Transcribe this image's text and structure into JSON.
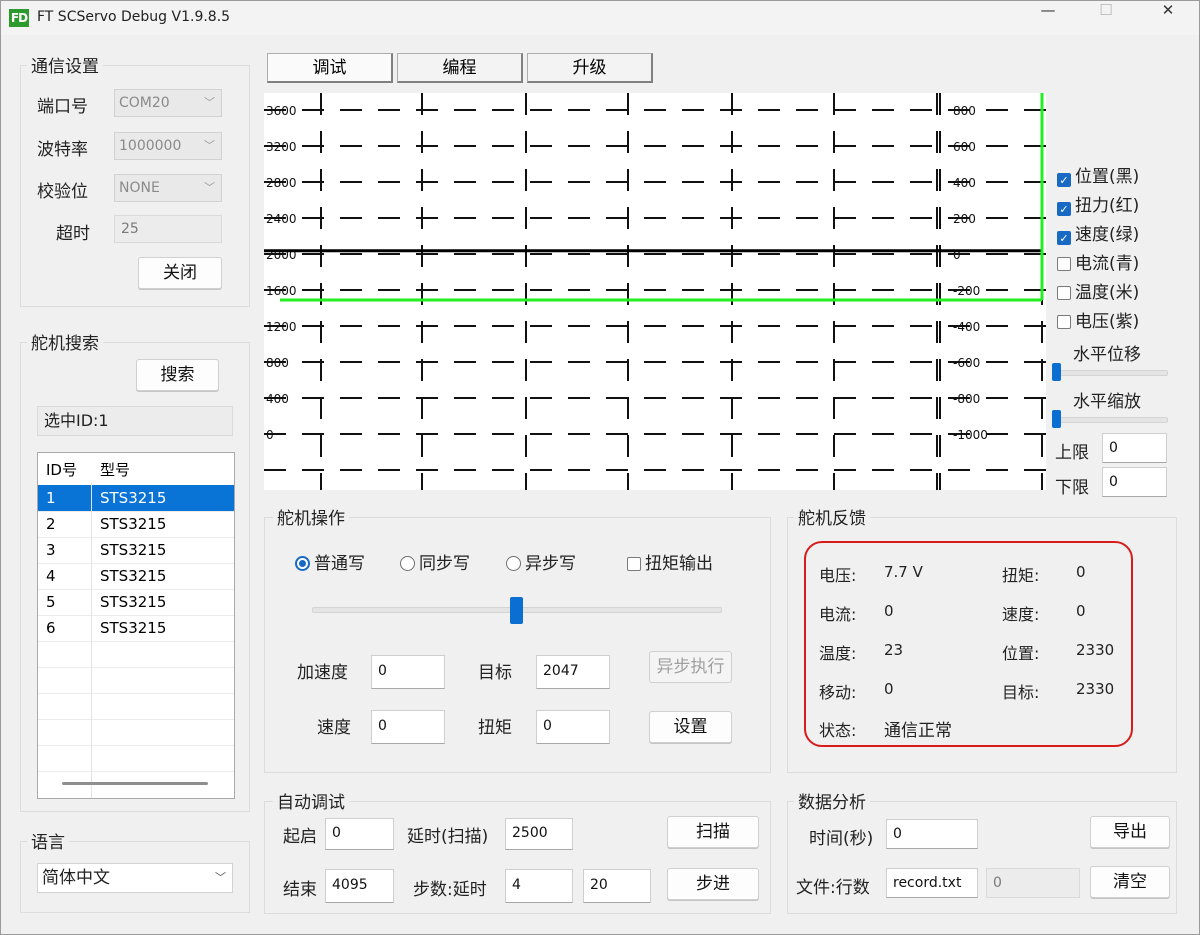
{
  "window": {
    "title": "FT SCServo Debug V1.9.8.5",
    "icon_text": "FD",
    "minimize": "—",
    "maximize": "☐",
    "close": "✕"
  },
  "comm": {
    "title": "通信设置",
    "port_label": "端口号",
    "port_value": "COM20",
    "baud_label": "波特率",
    "baud_value": "1000000",
    "parity_label": "校验位",
    "parity_value": "NONE",
    "timeout_label": "超时",
    "timeout_value": "25",
    "close_button": "关闭"
  },
  "search": {
    "title": "舵机搜索",
    "button": "搜索",
    "selected": "选中ID:1",
    "col_id": "ID号",
    "col_model": "型号",
    "rows": [
      {
        "id": "1",
        "model": "STS3215"
      },
      {
        "id": "2",
        "model": "STS3215"
      },
      {
        "id": "3",
        "model": "STS3215"
      },
      {
        "id": "4",
        "model": "STS3215"
      },
      {
        "id": "5",
        "model": "STS3215"
      },
      {
        "id": "6",
        "model": "STS3215"
      }
    ],
    "selected_index": 0
  },
  "language": {
    "title": "语言",
    "value": "简体中文"
  },
  "tabs": [
    {
      "label": "调试"
    },
    {
      "label": "编程"
    },
    {
      "label": "升级"
    }
  ],
  "active_tab": 0,
  "chart": {
    "left_ticks": [
      "3600",
      "3200",
      "2800",
      "2400",
      "2000",
      "1600",
      "1200",
      "800",
      "400",
      "0"
    ],
    "right_ticks": [
      "800",
      "600",
      "400",
      "200",
      "0",
      "-200",
      "-400",
      "-600",
      "-800",
      "-1000"
    ],
    "position_level": 2047,
    "speed_level": -250,
    "position_color": "#000000",
    "speed_color": "#22ee22"
  },
  "legend": [
    {
      "label": "位置(黑)",
      "checked": true
    },
    {
      "label": "扭力(红)",
      "checked": true
    },
    {
      "label": "速度(绿)",
      "checked": true
    },
    {
      "label": "电流(青)",
      "checked": false
    },
    {
      "label": "温度(米)",
      "checked": false
    },
    {
      "label": "电压(紫)",
      "checked": false
    }
  ],
  "hscroll": {
    "shift_label": "水平位移",
    "zoom_label": "水平缩放",
    "upper_label": "上限",
    "upper_value": "0",
    "lower_label": "下限",
    "lower_value": "0"
  },
  "op": {
    "title": "舵机操作",
    "radio_normal": "普通写",
    "radio_sync": "同步写",
    "radio_async": "异步写",
    "torque_out": "扭矩输出",
    "slider_value": 0.5,
    "accel_label": "加速度",
    "accel_value": "0",
    "target_label": "目标",
    "target_value": "2047",
    "async_exec": "异步执行",
    "speed_label": "速度",
    "speed_value": "0",
    "torque_label": "扭矩",
    "torque_value": "0",
    "set_button": "设置"
  },
  "feedback": {
    "title": "舵机反馈",
    "voltage_label": "电压:",
    "voltage_value": "7.7 V",
    "torque_label": "扭矩:",
    "torque_value": "0",
    "current_label": "电流:",
    "current_value": "0",
    "speed_label": "速度:",
    "speed_value": "0",
    "temp_label": "温度:",
    "temp_value": "23",
    "position_label": "位置:",
    "position_value": "2330",
    "move_label": "移动:",
    "move_value": "0",
    "target_label": "目标:",
    "target_value": "2330",
    "status_label": "状态:",
    "status_value": "通信正常",
    "highlight_color": "#d81c1c"
  },
  "auto": {
    "title": "自动调试",
    "start_label": "起启",
    "start_value": "0",
    "delay_scan_label": "延时(扫描)",
    "delay_scan_value": "2500",
    "scan_button": "扫描",
    "end_label": "结束",
    "end_value": "4095",
    "step_delay_label": "步数:延时",
    "step_value": "4",
    "delay_value": "20",
    "step_button": "步进"
  },
  "analysis": {
    "title": "数据分析",
    "time_label": "时间(秒)",
    "time_value": "0",
    "export_button": "导出",
    "file_label": "文件:行数",
    "file_value": "record.txt",
    "rows_value": "0",
    "clear_button": "清空"
  }
}
